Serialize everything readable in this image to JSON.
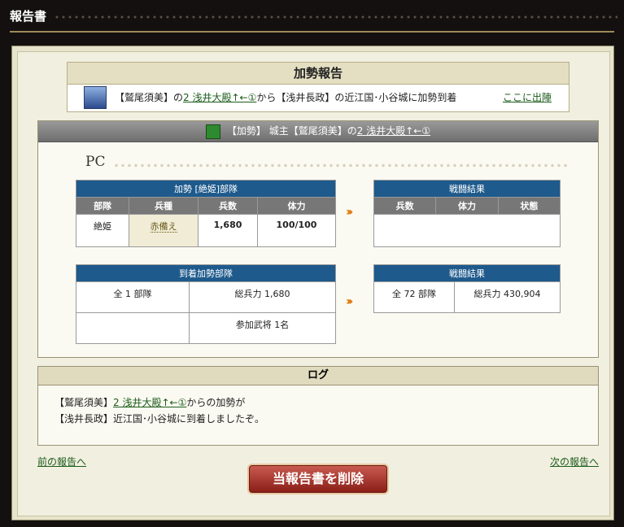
{
  "window": {
    "title": "報告書"
  },
  "report": {
    "heading": "加勢報告",
    "sender": "【鷲尾須美】",
    "mid1": "の",
    "player": "2 浅井大殿↑←①",
    "mid2": "から",
    "lord": "【浅井長政】",
    "tail": "の近江国･小谷城に加勢到着",
    "action_link": "ここに出陣"
  },
  "battle": {
    "header_pre": "【加勢】 城主",
    "header_lord": "【鷲尾須美】",
    "header_mid": "の",
    "header_player": "2 浅井大殿↑←①",
    "pc_label": "PC",
    "unit_table": {
      "title": "加勢 [絶姫]部隊",
      "columns": [
        "部隊",
        "兵種",
        "兵数",
        "体力"
      ],
      "row": [
        "絶姫",
        "赤備え",
        "1,680",
        "100/100"
      ]
    },
    "result_table_1": {
      "title": "戦闘結果",
      "columns": [
        "兵数",
        "体力",
        "状態"
      ]
    },
    "arrival_table": {
      "title": "到着加勢部隊",
      "units": "全 1 部隊",
      "total": "総兵力 1,680",
      "generals": "参加武将 1名"
    },
    "result_table_2": {
      "title": "戦闘結果",
      "units": "全 72 部隊",
      "total": "総兵力 430,904"
    }
  },
  "log": {
    "heading": "ログ",
    "line1_sender": "【鷲尾須美】",
    "line1_player": "2 浅井大殿↑←①",
    "line1_tail": "からの加勢が",
    "line2": "【浅井長政】近江国･小谷城に到着しましたぞ。"
  },
  "nav": {
    "prev": "前の報告へ",
    "next": "次の報告へ"
  },
  "delete_button": "当報告書を削除"
}
